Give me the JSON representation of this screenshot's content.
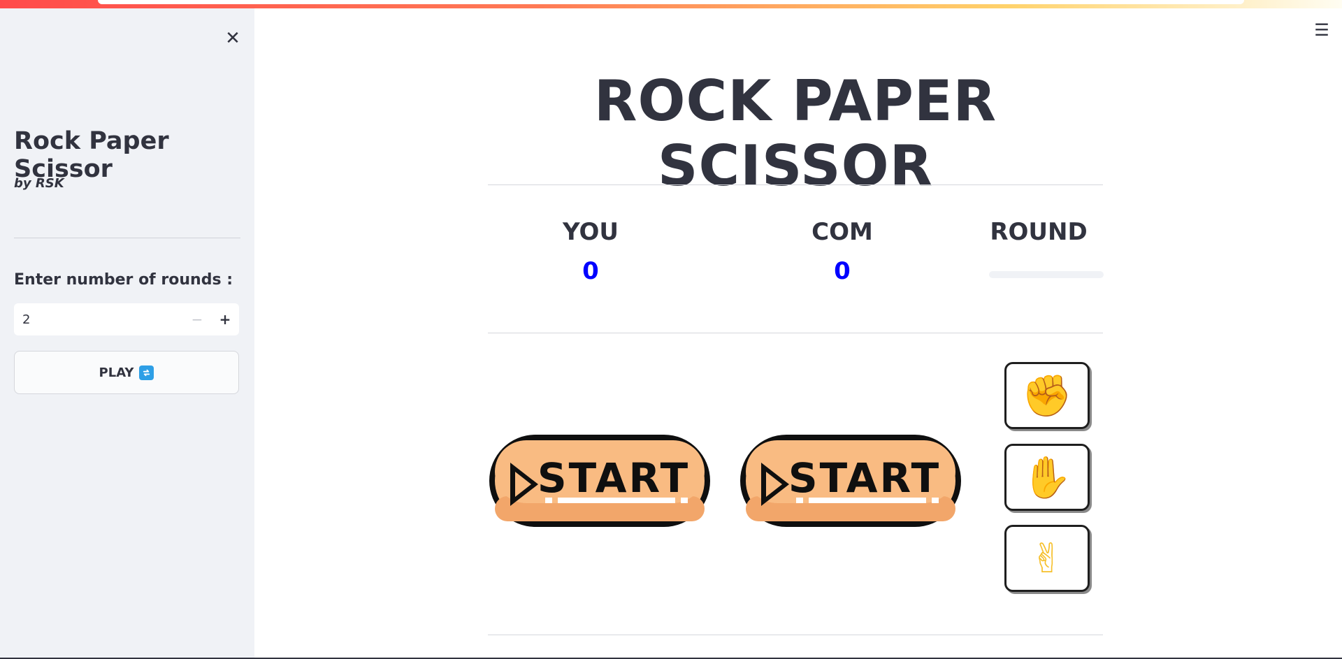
{
  "sidebar": {
    "close_icon": "close-icon",
    "title": "Rock Paper Scissor",
    "author": "by RSK",
    "rounds_label": "Enter number of rounds :",
    "rounds_value": "2",
    "minus_symbol": "−",
    "plus_symbol": "+",
    "play_label": "PLAY",
    "play_icon": "repeat-icon",
    "play_icon_glyph": "🔃"
  },
  "header": {
    "menu_icon": "hamburger-menu-icon",
    "menu_glyph": "☰",
    "close_glyph": "✕"
  },
  "main": {
    "title": "ROCK PAPER SCISSOR",
    "scoreboard": {
      "you_label": "YOU",
      "you_score": "0",
      "com_label": "COM",
      "com_score": "0",
      "round_label": "ROUND",
      "round_progress": 0
    },
    "start_badge_text": "START",
    "hands": [
      {
        "name": "rock",
        "glyph": "✊"
      },
      {
        "name": "paper",
        "glyph": "✋"
      },
      {
        "name": "scissors",
        "glyph": "✌"
      }
    ]
  },
  "colors": {
    "score": "#0000ff",
    "accent": "#ff4b4b",
    "sidebar_bg": "#f0f2f6",
    "badge_fill": "#f9bb82"
  }
}
